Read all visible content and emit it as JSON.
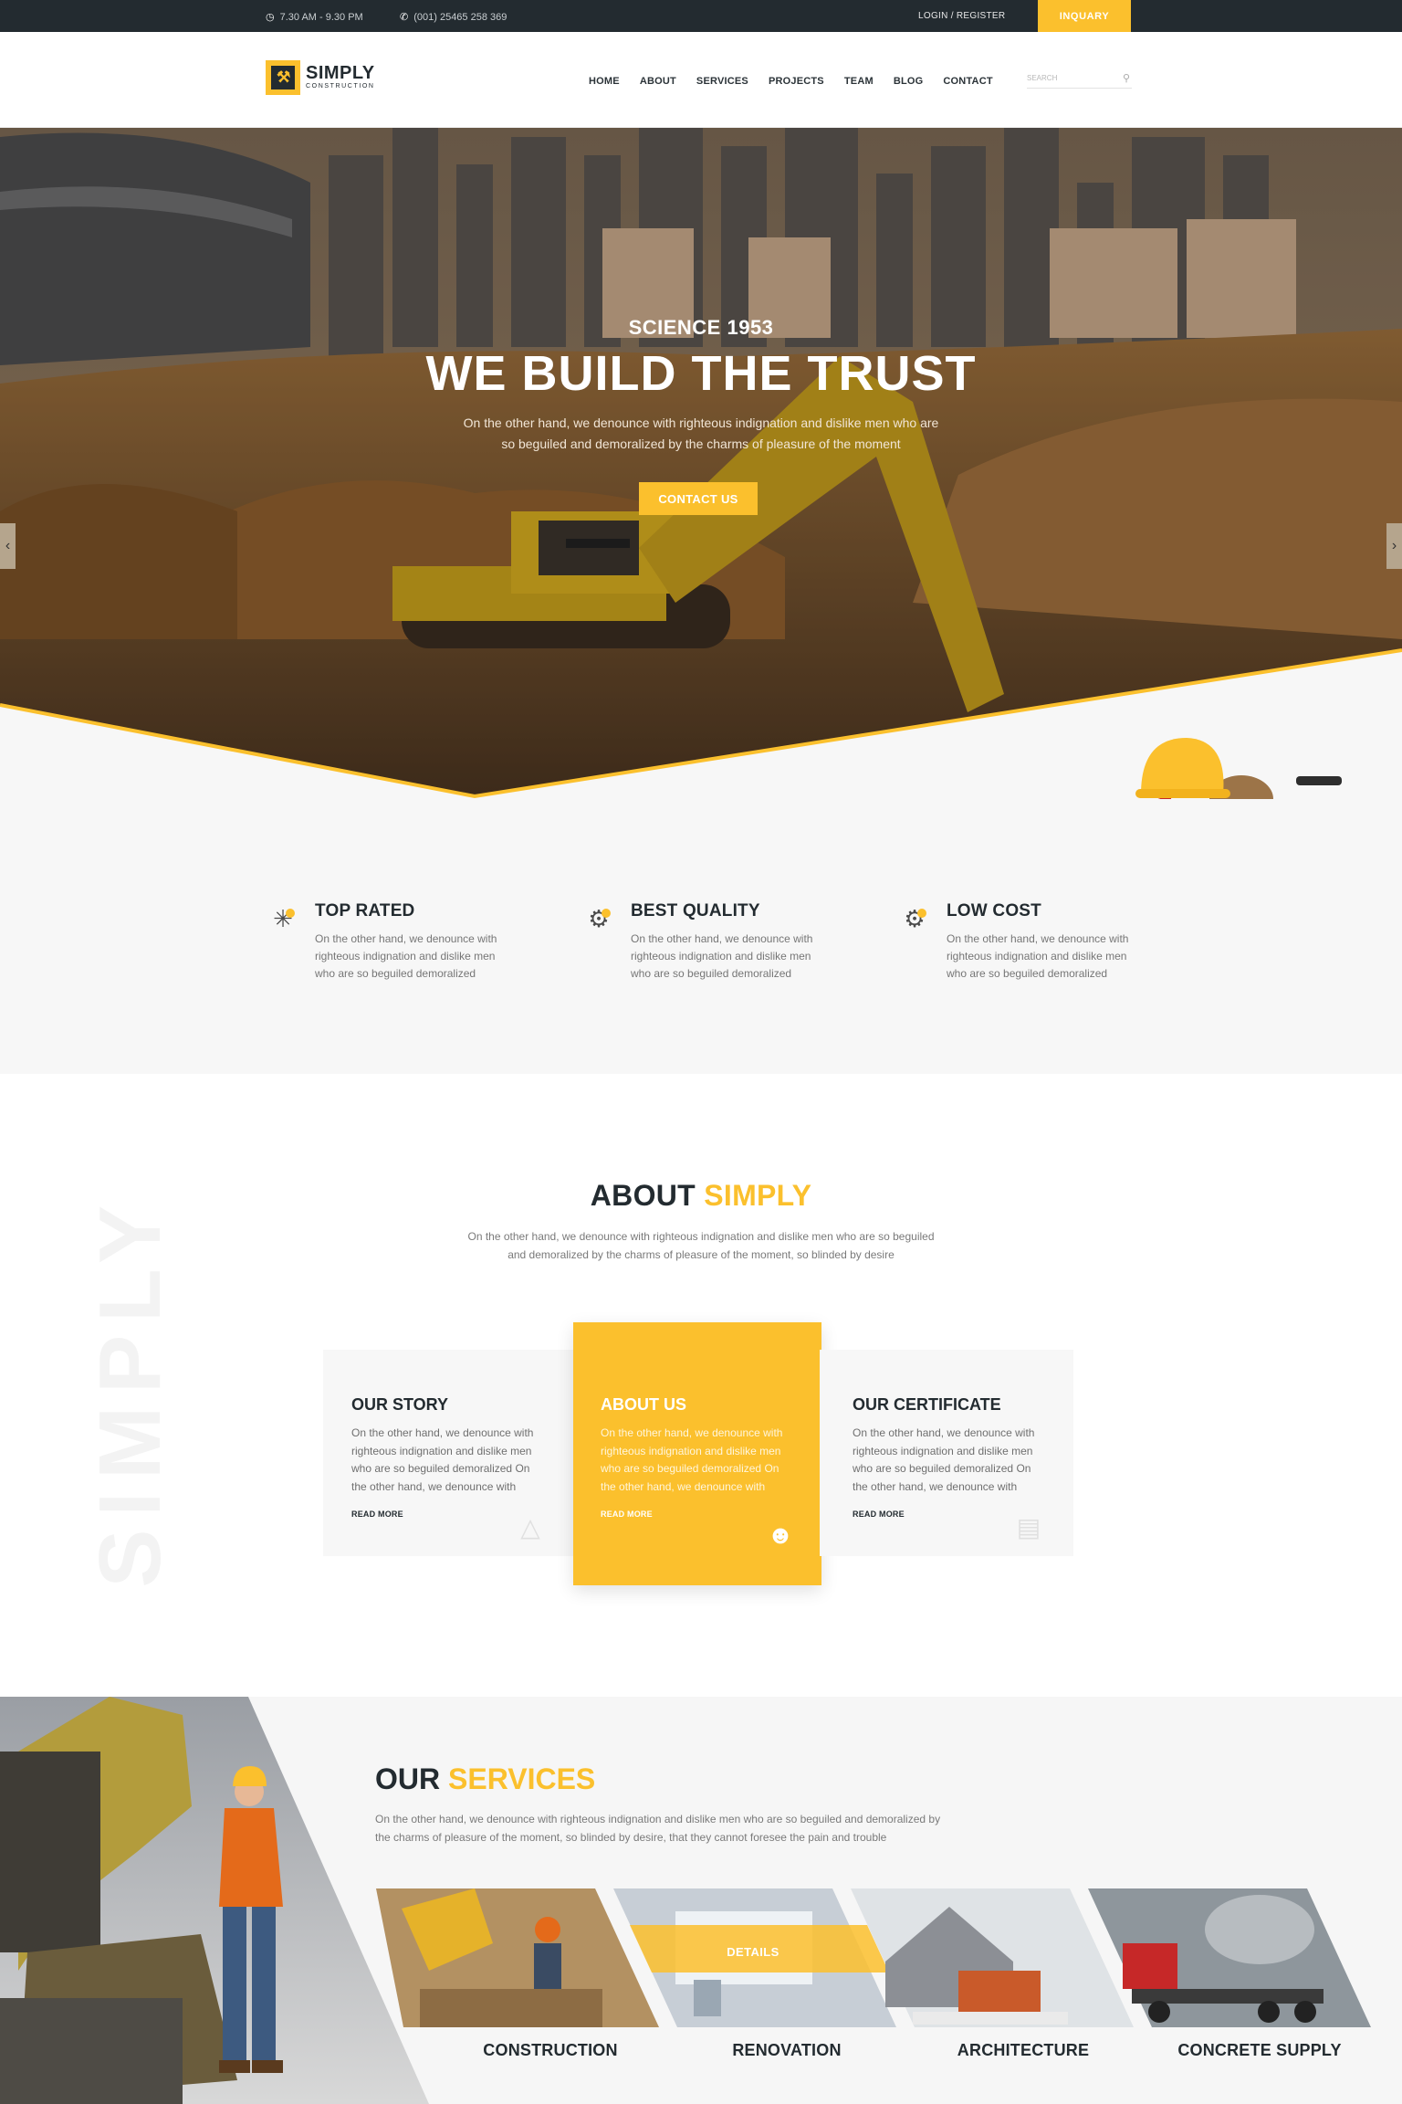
{
  "topbar": {
    "hours": "7.30 AM  -  9.30 PM",
    "phone": "(001) 25465 258 369",
    "login": "LOGIN",
    "register": "REGISTER",
    "inquiry": "INQUARY"
  },
  "header": {
    "logo_main": "SIMPLY",
    "logo_sub": "CONSTRUCTION",
    "nav": [
      "HOME",
      "ABOUT",
      "SERVICES",
      "PROJECTS",
      "TEAM",
      "BLOG",
      "CONTACT"
    ],
    "search_placeholder": "SEARCH"
  },
  "hero": {
    "subtitle": "SCIENCE 1953",
    "title": "WE BUILD THE TRUST",
    "desc_line1": "On the other hand, we denounce with righteous indignation and dislike men who are",
    "desc_line2": "so beguiled and demoralized by the charms of pleasure of the moment",
    "cta": "CONTACT US"
  },
  "features": [
    {
      "title": "TOP RATED",
      "text": "On the other hand, we denounce with righteous indignation and dislike men who are so beguiled demoralized",
      "icon": "star-badge-icon"
    },
    {
      "title": "BEST QUALITY",
      "text": "On the other hand, we denounce with righteous indignation and dislike men who are so beguiled demoralized",
      "icon": "gear-hand-icon"
    },
    {
      "title": "LOW COST",
      "text": "On the other hand, we denounce with righteous indignation and dislike men who are so beguiled demoralized",
      "icon": "coin-gear-icon"
    }
  ],
  "about": {
    "title_a": "ABOUT",
    "title_b": "SIMPLY",
    "watermark": "SIMPLY",
    "intro_line1": "On the other hand, we denounce with righteous indignation and dislike men who are so beguiled",
    "intro_line2": "and demoralized by the charms of pleasure of the moment, so blinded by desire",
    "cards": [
      {
        "title": "OUR STORY",
        "text": "On the other hand, we denounce with righteous indignation and dislike men who are so beguiled demoralized On the other hand, we denounce with",
        "read_more": "READ MORE"
      },
      {
        "title": "ABOUT US",
        "text": "On the other hand, we denounce with righteous indignation and dislike men who are so beguiled demoralized On the other hand, we denounce with",
        "read_more": "READ MORE"
      },
      {
        "title": "OUR CERTIFICATE",
        "text": "On the other hand, we denounce with righteous indignation and dislike men who are so beguiled demoralized On the other hand, we denounce with",
        "read_more": "READ MORE"
      }
    ]
  },
  "services": {
    "title_a": "OUR",
    "title_b": "SERVICES",
    "desc_line1": "On the other hand, we denounce with righteous indignation and dislike men who are so beguiled and demoralized by",
    "desc_line2": "the charms of pleasure of the moment, so blinded by desire, that they cannot foresee the pain and trouble",
    "details": "DETAILS",
    "items": [
      "CONSTRUCTION",
      "RENOVATION",
      "ARCHITECTURE",
      "CONCRETE SUPPLY"
    ]
  },
  "colors": {
    "accent": "#fbc02d",
    "dark": "#232b30"
  }
}
